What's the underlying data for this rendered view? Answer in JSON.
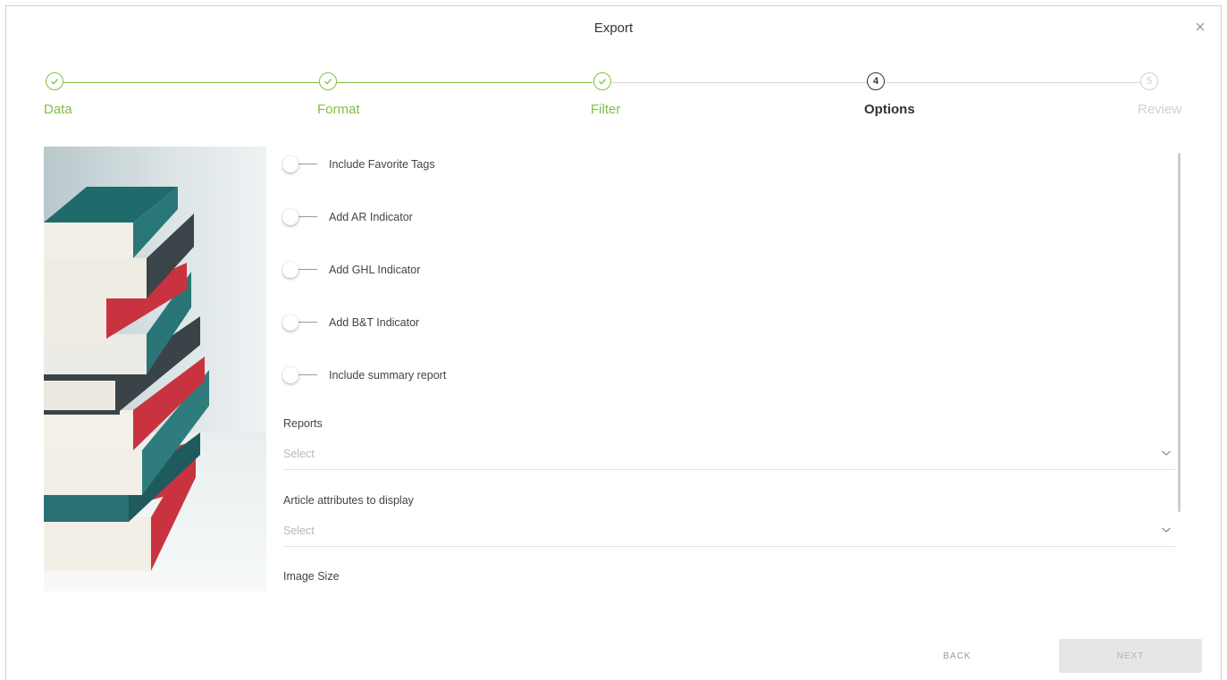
{
  "dialog": {
    "title": "Export"
  },
  "stepper": {
    "steps": [
      {
        "label": "Data",
        "number": "1",
        "state": "done"
      },
      {
        "label": "Format",
        "number": "2",
        "state": "done"
      },
      {
        "label": "Filter",
        "number": "3",
        "state": "done"
      },
      {
        "label": "Options",
        "number": "4",
        "state": "active"
      },
      {
        "label": "Review",
        "number": "5",
        "state": "todo"
      }
    ]
  },
  "options": {
    "toggles": [
      {
        "label": "Include Favorite Tags",
        "on": false
      },
      {
        "label": "Add AR Indicator",
        "on": false
      },
      {
        "label": "Add GHL Indicator",
        "on": false
      },
      {
        "label": "Add B&T Indicator",
        "on": false
      },
      {
        "label": "Include summary report",
        "on": false
      }
    ],
    "reports": {
      "label": "Reports",
      "placeholder": "Select"
    },
    "article_attributes": {
      "label": "Article attributes to display",
      "placeholder": "Select"
    },
    "image_size": {
      "label": "Image Size"
    }
  },
  "footer": {
    "back_label": "BACK",
    "next_label": "NEXT"
  },
  "colors": {
    "accent": "#7dc242",
    "active": "#333333",
    "inactive": "#cfcfcf"
  }
}
